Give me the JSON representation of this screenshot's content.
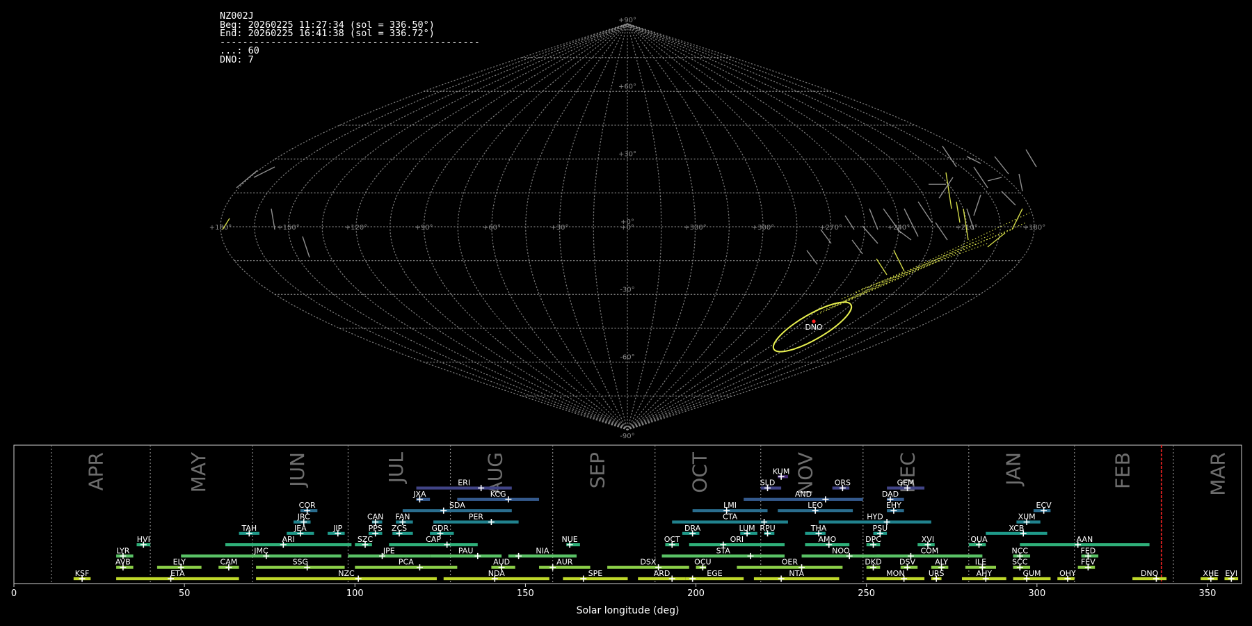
{
  "info_panel": {
    "station": "NZ002J",
    "begin": "Beg: 20260225 11:27:34 (sol = 336.50°)",
    "end": "End: 20260225 16:41:38 (sol = 336.72°)",
    "separator": "----------------------------------------------",
    "count_other": "...: 60",
    "count_dno": "DNO: 7"
  },
  "sky_map": {
    "projection": "sinusoidal",
    "lat_labels": [
      "+90°",
      "+60°",
      "+30°",
      "+0°",
      "-30°",
      "-60°",
      "-90°"
    ],
    "lon_labels": [
      "+180°",
      "+150°",
      "+120°",
      "+90°",
      "+60°",
      "+30°",
      "+0°",
      "+330°",
      "+300°",
      "+270°",
      "+240°",
      "+210°",
      "+180°"
    ],
    "radiant_label": "DNO",
    "colors": {
      "grid": "#8c8c8c",
      "meteor_dno": "#e8f050",
      "meteor_other": "#a0a0a0",
      "radiant": "#ff2020"
    }
  },
  "chart_data": {
    "type": "bar",
    "title": "",
    "xlabel": "Solar longitude (deg)",
    "ylabel": "",
    "xlim": [
      0,
      360
    ],
    "xticks": [
      0,
      50,
      100,
      150,
      200,
      250,
      300,
      350
    ],
    "current_sol": 336.5,
    "month_labels": [
      {
        "label": "APR",
        "sol": 24
      },
      {
        "label": "MAY",
        "sol": 54
      },
      {
        "label": "JUN",
        "sol": 83
      },
      {
        "label": "JUL",
        "sol": 112
      },
      {
        "label": "AUG",
        "sol": 141
      },
      {
        "label": "SEP",
        "sol": 171
      },
      {
        "label": "OCT",
        "sol": 201
      },
      {
        "label": "NOV",
        "sol": 232
      },
      {
        "label": "DEC",
        "sol": 262
      },
      {
        "label": "JAN",
        "sol": 293
      },
      {
        "label": "FEB",
        "sol": 325
      },
      {
        "label": "MAR",
        "sol": 353
      }
    ],
    "month_boundaries": [
      11,
      40,
      70,
      98,
      128,
      158,
      188,
      219,
      249,
      280,
      311,
      340
    ],
    "showers": [
      {
        "name": "KSF",
        "start": 17.5,
        "end": 22.5,
        "peak": 20,
        "row": 0
      },
      {
        "name": "ETA",
        "start": 30,
        "end": 66,
        "peak": 46,
        "row": 0
      },
      {
        "name": "NZC",
        "start": 71,
        "end": 124,
        "peak": 101,
        "row": 0
      },
      {
        "name": "NDA",
        "start": 126,
        "end": 157,
        "peak": 141,
        "row": 0
      },
      {
        "name": "SPE",
        "start": 161,
        "end": 180,
        "peak": 167,
        "row": 0
      },
      {
        "name": "ARD",
        "start": 183,
        "end": 197,
        "peak": 193,
        "row": 0
      },
      {
        "name": "EGE",
        "start": 197,
        "end": 214,
        "peak": 199,
        "row": 0
      },
      {
        "name": "NTA",
        "start": 217,
        "end": 242,
        "peak": 225,
        "row": 0
      },
      {
        "name": "MON",
        "start": 250,
        "end": 267,
        "peak": 261,
        "row": 0
      },
      {
        "name": "URS",
        "start": 269,
        "end": 272,
        "peak": 270.5,
        "row": 0
      },
      {
        "name": "AHY",
        "start": 278,
        "end": 291,
        "peak": 285,
        "row": 0
      },
      {
        "name": "GUM",
        "start": 293,
        "end": 304,
        "peak": 297,
        "row": 0
      },
      {
        "name": "OHY",
        "start": 306,
        "end": 311,
        "peak": 309,
        "row": 0
      },
      {
        "name": "DNO",
        "start": 328,
        "end": 338,
        "peak": 335,
        "row": 0
      },
      {
        "name": "XHE",
        "start": 348,
        "end": 353,
        "peak": 351,
        "row": 0
      },
      {
        "name": "EVI",
        "start": 355,
        "end": 359,
        "peak": 357,
        "row": 0
      },
      {
        "name": "AVB",
        "start": 30,
        "end": 35,
        "peak": 32,
        "row": 1
      },
      {
        "name": "ELY",
        "start": 42,
        "end": 55,
        "peak": 49,
        "row": 1
      },
      {
        "name": "CAM",
        "start": 60,
        "end": 66,
        "peak": 63,
        "row": 1
      },
      {
        "name": "SSG",
        "start": 71,
        "end": 97,
        "peak": 86,
        "row": 1
      },
      {
        "name": "PCA",
        "start": 100,
        "end": 130,
        "peak": 119,
        "row": 1
      },
      {
        "name": "AUD",
        "start": 140,
        "end": 147,
        "peak": 143,
        "row": 1
      },
      {
        "name": "AUR",
        "start": 154,
        "end": 169,
        "peak": 158,
        "row": 1
      },
      {
        "name": "DSX",
        "start": 174,
        "end": 198,
        "peak": 189,
        "row": 1
      },
      {
        "name": "OCU",
        "start": 200,
        "end": 203,
        "peak": 202,
        "row": 1
      },
      {
        "name": "OER",
        "start": 212,
        "end": 243,
        "peak": 231,
        "row": 1
      },
      {
        "name": "DKD",
        "start": 250,
        "end": 254,
        "peak": 252,
        "row": 1
      },
      {
        "name": "DSV",
        "start": 260,
        "end": 265,
        "peak": 262,
        "row": 1
      },
      {
        "name": "ALY",
        "start": 269,
        "end": 274,
        "peak": 272,
        "row": 1
      },
      {
        "name": "ILE",
        "start": 279,
        "end": 288,
        "peak": 284,
        "row": 1
      },
      {
        "name": "SCC",
        "start": 293,
        "end": 298,
        "peak": 295,
        "row": 1
      },
      {
        "name": "FEV",
        "start": 312,
        "end": 317,
        "peak": 315,
        "row": 1
      },
      {
        "name": "LYR",
        "start": 30,
        "end": 35,
        "peak": 32,
        "row": 2
      },
      {
        "name": "JMC",
        "start": 49,
        "end": 96,
        "peak": 74,
        "row": 2
      },
      {
        "name": "JPE",
        "start": 98,
        "end": 122,
        "peak": 108,
        "row": 2
      },
      {
        "name": "PAU",
        "start": 122,
        "end": 143,
        "peak": 136,
        "row": 2
      },
      {
        "name": "NIA",
        "start": 145,
        "end": 165,
        "peak": 148,
        "row": 2
      },
      {
        "name": "STA",
        "start": 190,
        "end": 226,
        "peak": 216,
        "row": 2
      },
      {
        "name": "NOO",
        "start": 231,
        "end": 254,
        "peak": 245,
        "row": 2
      },
      {
        "name": "COM",
        "start": 253,
        "end": 284,
        "peak": 263,
        "row": 2
      },
      {
        "name": "NCC",
        "start": 293,
        "end": 298,
        "peak": 295,
        "row": 2
      },
      {
        "name": "FED",
        "start": 313,
        "end": 318,
        "peak": 315,
        "row": 2
      },
      {
        "name": "HVI",
        "start": 36,
        "end": 40,
        "peak": 38,
        "row": 3
      },
      {
        "name": "ARI",
        "start": 62,
        "end": 99,
        "peak": 79,
        "row": 3
      },
      {
        "name": "SZC",
        "start": 100,
        "end": 105,
        "peak": 103,
        "row": 3
      },
      {
        "name": "CAP",
        "start": 110,
        "end": 136,
        "peak": 127,
        "row": 3
      },
      {
        "name": "NUE",
        "start": 162,
        "end": 166,
        "peak": 163,
        "row": 3
      },
      {
        "name": "OCT",
        "start": 191,
        "end": 195,
        "peak": 193,
        "row": 3
      },
      {
        "name": "ORI",
        "start": 198,
        "end": 226,
        "peak": 208,
        "row": 3
      },
      {
        "name": "AMO",
        "start": 232,
        "end": 245,
        "peak": 239,
        "row": 3
      },
      {
        "name": "DPC",
        "start": 250,
        "end": 254,
        "peak": 252,
        "row": 3
      },
      {
        "name": "XVI",
        "start": 265,
        "end": 270,
        "peak": 268,
        "row": 3
      },
      {
        "name": "QUA",
        "start": 280,
        "end": 285,
        "peak": 283,
        "row": 3
      },
      {
        "name": "AAN",
        "start": 295,
        "end": 333,
        "peak": 312,
        "row": 3
      },
      {
        "name": "TAH",
        "start": 66,
        "end": 72,
        "peak": 69,
        "row": 4
      },
      {
        "name": "JEA",
        "start": 80,
        "end": 88,
        "peak": 84,
        "row": 4
      },
      {
        "name": "JIP",
        "start": 92,
        "end": 97,
        "peak": 95,
        "row": 4
      },
      {
        "name": "PPS",
        "start": 104,
        "end": 108,
        "peak": 106,
        "row": 4
      },
      {
        "name": "ZCS",
        "start": 111,
        "end": 117,
        "peak": 113,
        "row": 4
      },
      {
        "name": "GDR",
        "start": 122,
        "end": 129,
        "peak": 125,
        "row": 4
      },
      {
        "name": "DRA",
        "start": 196,
        "end": 201,
        "peak": 199,
        "row": 4
      },
      {
        "name": "LUM",
        "start": 213,
        "end": 218,
        "peak": 215,
        "row": 4
      },
      {
        "name": "RPU",
        "start": 220,
        "end": 223,
        "peak": 221,
        "row": 4
      },
      {
        "name": "THA",
        "start": 232,
        "end": 238,
        "peak": 236,
        "row": 4
      },
      {
        "name": "PSU",
        "start": 252,
        "end": 256,
        "peak": 254,
        "row": 4
      },
      {
        "name": "XCB",
        "start": 285,
        "end": 303,
        "peak": 296,
        "row": 4
      },
      {
        "name": "JRC",
        "start": 82,
        "end": 87,
        "peak": 85,
        "row": 5
      },
      {
        "name": "CAN",
        "start": 105,
        "end": 108,
        "peak": 106,
        "row": 5
      },
      {
        "name": "FAN",
        "start": 112,
        "end": 117,
        "peak": 114,
        "row": 5
      },
      {
        "name": "PER",
        "start": 123,
        "end": 148,
        "peak": 140,
        "row": 5
      },
      {
        "name": "CTA",
        "start": 193,
        "end": 227,
        "peak": 220,
        "row": 5
      },
      {
        "name": "HYD",
        "start": 236,
        "end": 269,
        "peak": 256,
        "row": 5
      },
      {
        "name": "XUM",
        "start": 294,
        "end": 301,
        "peak": 297,
        "row": 5
      },
      {
        "name": "COR",
        "start": 84,
        "end": 89,
        "peak": 86,
        "row": 6
      },
      {
        "name": "SDA",
        "start": 114,
        "end": 146,
        "peak": 126,
        "row": 6
      },
      {
        "name": "LMI",
        "start": 199,
        "end": 221,
        "peak": 209,
        "row": 6
      },
      {
        "name": "LEO",
        "start": 224,
        "end": 246,
        "peak": 235,
        "row": 6
      },
      {
        "name": "EHY",
        "start": 256,
        "end": 261,
        "peak": 258,
        "row": 6
      },
      {
        "name": "ECV",
        "start": 299,
        "end": 304,
        "peak": 302,
        "row": 6
      },
      {
        "name": "JXA",
        "start": 118,
        "end": 122,
        "peak": 119,
        "row": 7
      },
      {
        "name": "KCG",
        "start": 130,
        "end": 154,
        "peak": 145,
        "row": 7
      },
      {
        "name": "AND",
        "start": 214,
        "end": 249,
        "peak": 238,
        "row": 7
      },
      {
        "name": "DAD",
        "start": 256,
        "end": 261,
        "peak": 257,
        "row": 7
      },
      {
        "name": "ERI",
        "start": 118,
        "end": 146,
        "peak": 137,
        "row": 8
      },
      {
        "name": "SLD",
        "start": 219,
        "end": 225,
        "peak": 221,
        "row": 8
      },
      {
        "name": "ORS",
        "start": 240,
        "end": 245,
        "peak": 243,
        "row": 8
      },
      {
        "name": "GEM",
        "start": 256,
        "end": 267,
        "peak": 262,
        "row": 8
      },
      {
        "name": "KUM",
        "start": 224,
        "end": 227,
        "peak": 225,
        "row": 9
      }
    ]
  }
}
